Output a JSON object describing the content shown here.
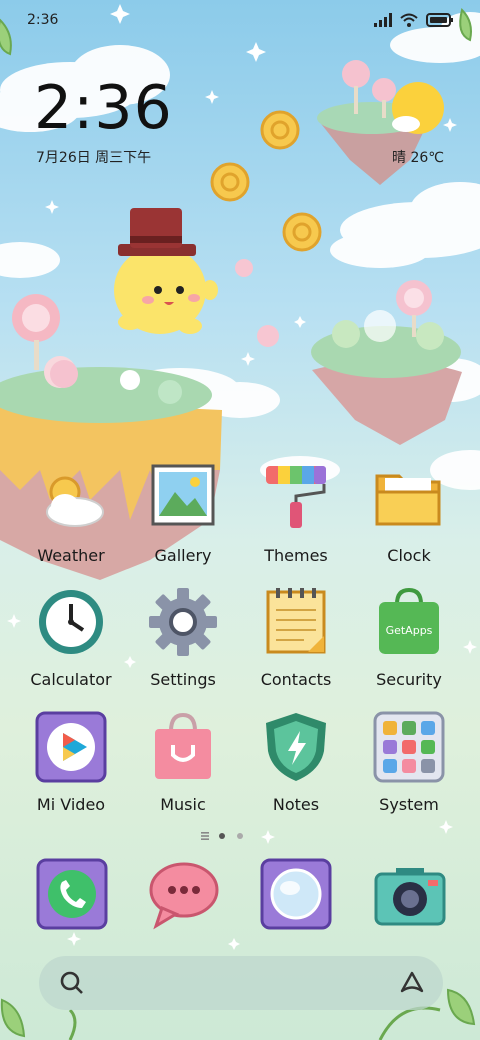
{
  "status": {
    "time": "2:36"
  },
  "clock": {
    "time": "2:36",
    "date": "7月26日 周三下午"
  },
  "weather": {
    "condition": "晴",
    "temperature": "26℃",
    "text": "晴 26℃"
  },
  "apps": [
    {
      "label": "Weather",
      "icon": "weather-icon"
    },
    {
      "label": "Gallery",
      "icon": "gallery-icon"
    },
    {
      "label": "Themes",
      "icon": "themes-icon"
    },
    {
      "label": "Clock",
      "icon": "folder-icon"
    },
    {
      "label": "Calculator",
      "icon": "clock-icon"
    },
    {
      "label": "Settings",
      "icon": "gear-icon"
    },
    {
      "label": "Contacts",
      "icon": "notepad-icon"
    },
    {
      "label": "Security",
      "icon": "getapps-icon"
    },
    {
      "label": "Mi Video",
      "icon": "play-icon"
    },
    {
      "label": "Music",
      "icon": "bag-icon"
    },
    {
      "label": "Notes",
      "icon": "shield-icon"
    },
    {
      "label": "System",
      "icon": "system-folder-icon"
    }
  ],
  "getapps_badge": "GetApps",
  "pages": {
    "count": 2,
    "current": 1
  },
  "dock": [
    "phone-icon",
    "messages-icon",
    "browser-icon",
    "camera-icon"
  ],
  "search": {
    "placeholder": ""
  }
}
